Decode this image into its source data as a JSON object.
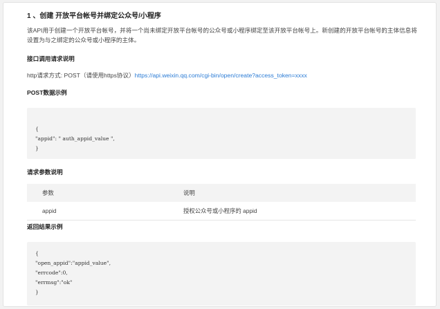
{
  "section": {
    "title": "1 、创建 开放平台帐号并绑定公众号/小程序",
    "description": "该API用于创建一个开放平台帐号，并将一个尚未绑定开放平台帐号的公众号或小程序绑定至该开放平台帐号上。新创建的开放平台帐号的主体信息将设置为与之绑定的公众号或小程序的主体。"
  },
  "request": {
    "heading": "接口调用请求说明",
    "method_prefix": "http请求方式: POST（请使用https协议）",
    "url": "https://api.weixin.qq.com/cgi-bin/open/create?access_token=xxxx"
  },
  "post_example": {
    "heading": "POST数据示例",
    "lines": [
      "{",
      "\"appid\": \" auth_appid_value \",",
      "}"
    ]
  },
  "params": {
    "heading": "请求参数说明",
    "columns": [
      "参数",
      "说明"
    ],
    "rows": [
      [
        "appid",
        "授权公众号或小程序的 appid"
      ]
    ]
  },
  "result_example": {
    "heading": "返回结果示例",
    "lines": [
      "{",
      "\"open_appid\":\"appid_value\",",
      "\"errcode\":0,",
      "\"errmsg\":\"ok\"",
      "}"
    ]
  }
}
